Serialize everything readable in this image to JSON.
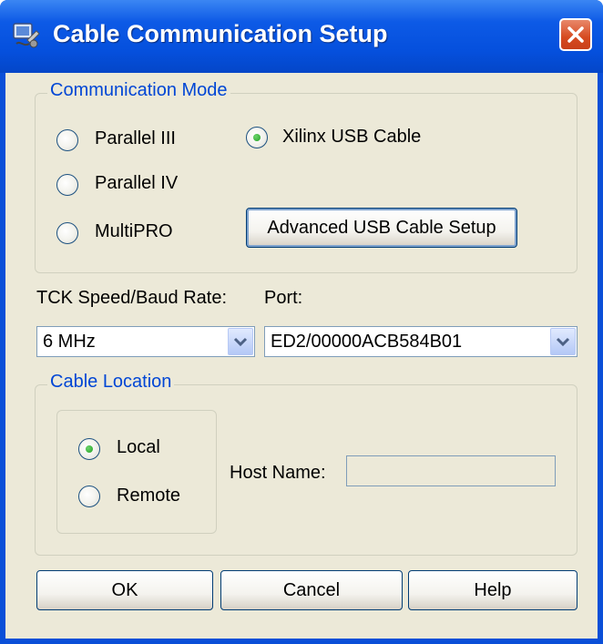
{
  "window": {
    "title": "Cable Communication Setup"
  },
  "communication_mode": {
    "title": "Communication Mode",
    "options": [
      {
        "label": "Parallel III",
        "selected": false
      },
      {
        "label": "Parallel IV",
        "selected": false
      },
      {
        "label": "MultiPRO",
        "selected": false
      },
      {
        "label": "Xilinx USB Cable",
        "selected": true
      }
    ],
    "advanced_button": "Advanced USB Cable Setup"
  },
  "speed": {
    "label": "TCK Speed/Baud Rate:",
    "value": "6 MHz"
  },
  "port": {
    "label": "Port:",
    "value": "ED2/00000ACB584B01"
  },
  "cable_location": {
    "title": "Cable Location",
    "options": [
      {
        "label": "Local",
        "selected": true
      },
      {
        "label": "Remote",
        "selected": false
      }
    ],
    "host_name_label": "Host Name:",
    "host_name_value": ""
  },
  "buttons": {
    "ok": "OK",
    "cancel": "Cancel",
    "help": "Help"
  },
  "colors": {
    "titlebar": "#0550dd",
    "client": "#ece9d8",
    "group_title": "#0046d5",
    "close": "#d64a20"
  },
  "icons": [
    "app-icon",
    "close-icon",
    "chevron-down-icon"
  ]
}
